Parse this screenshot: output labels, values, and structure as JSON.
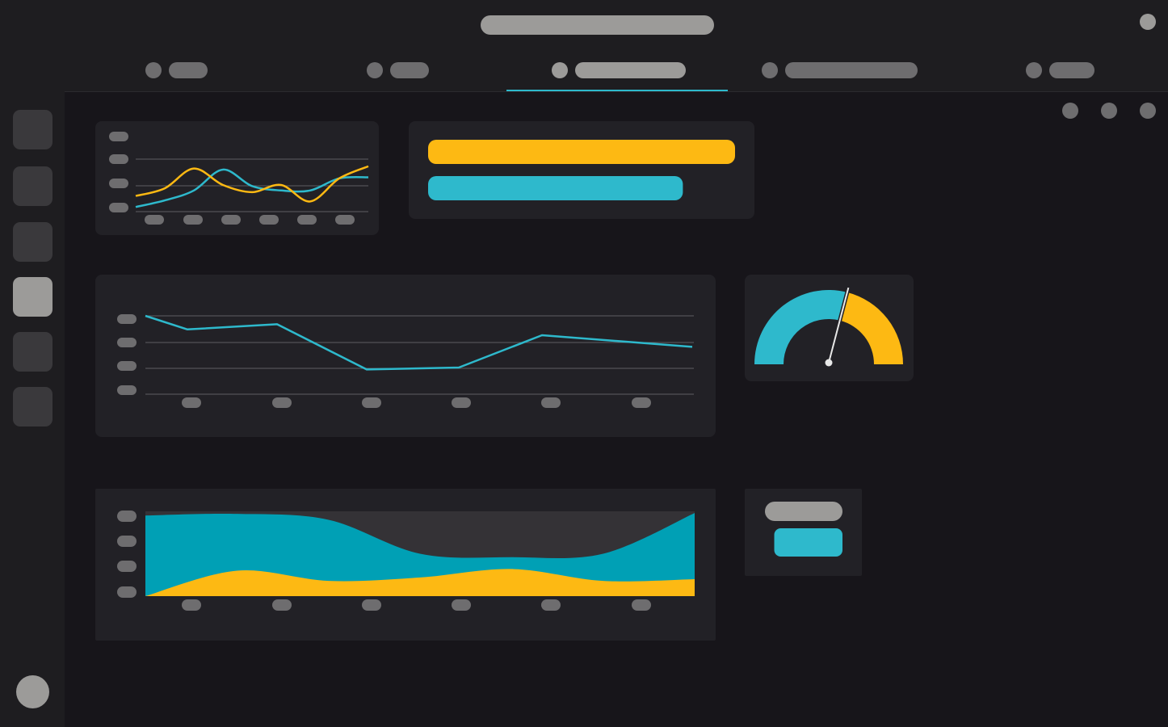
{
  "colors": {
    "accent_teal": "#2eb9cc",
    "accent_yellow": "#fdb913",
    "area_teal": "#00a0b5",
    "placeholder": "#6e6d6f",
    "placeholder_light": "#9c9b99",
    "panel": "#222126",
    "background": "#17151a"
  },
  "icons": {
    "logo": "app-logo-icon",
    "avatar": "user-avatar-icon"
  },
  "tabs": {
    "active_index": 2,
    "count": 5
  },
  "sidebar": {
    "active_index": 3,
    "count": 6
  },
  "chart_data": [
    {
      "type": "line",
      "series": [
        {
          "color": "#2eb9cc",
          "values": [
            10,
            22,
            40,
            78,
            48,
            40,
            40,
            62,
            64
          ]
        },
        {
          "color": "#fdb913",
          "values": [
            30,
            44,
            80,
            50,
            37,
            50,
            20,
            62,
            84
          ]
        }
      ],
      "grid": true
    },
    {
      "type": "bar",
      "orientation": "horizontal",
      "series": [
        {
          "color": "#fdb913",
          "values": [
            100
          ]
        },
        {
          "color": "#2eb9cc",
          "values": [
            83
          ]
        }
      ]
    },
    {
      "type": "line",
      "series": [
        {
          "color": "#2eb9cc",
          "values": [
            100,
            79,
            87,
            17,
            20,
            70,
            52
          ]
        }
      ],
      "grid": true
    },
    {
      "type": "gauge",
      "value": 58,
      "range": [
        0,
        100
      ],
      "colors": [
        "#2eb9cc",
        "#fdb913"
      ]
    },
    {
      "type": "area",
      "stacked": true,
      "series": [
        {
          "color": "#00a0b5",
          "values": [
            95,
            97,
            90,
            50,
            46,
            50,
            98
          ]
        },
        {
          "color": "#fdb913",
          "values": [
            0,
            30,
            18,
            22,
            32,
            18,
            20
          ]
        }
      ]
    },
    {
      "type": "bar",
      "orientation": "horizontal",
      "series": [
        {
          "color": "#9c9b99",
          "values": [
            100
          ]
        },
        {
          "color": "#2eb9cc",
          "values": [
            88
          ]
        }
      ]
    }
  ]
}
